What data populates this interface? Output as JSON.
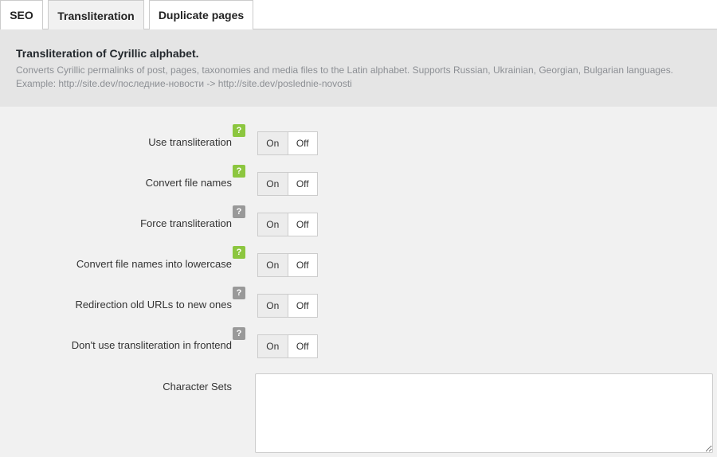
{
  "tabs": [
    {
      "label": "SEO"
    },
    {
      "label": "Transliteration"
    },
    {
      "label": "Duplicate pages"
    }
  ],
  "header": {
    "title": "Transliteration of Cyrillic alphabet.",
    "description": "Converts Cyrillic permalinks of post, pages, taxonomies and media files to the Latin alphabet. Supports Russian, Ukrainian, Georgian, Bulgarian languages. Example: http://site.dev/последние-новости -> http://site.dev/poslednie-novosti"
  },
  "settings": [
    {
      "label": "Use transliteration",
      "help_color": "#8cc63f",
      "on_label": "On",
      "off_label": "Off"
    },
    {
      "label": "Convert file names",
      "help_color": "#8cc63f",
      "on_label": "On",
      "off_label": "Off"
    },
    {
      "label": "Force transliteration",
      "help_color": "#999999",
      "on_label": "On",
      "off_label": "Off"
    },
    {
      "label": "Convert file names into lowercase",
      "help_color": "#8cc63f",
      "on_label": "On",
      "off_label": "Off"
    },
    {
      "label": "Redirection old URLs to new ones",
      "help_color": "#999999",
      "on_label": "On",
      "off_label": "Off"
    },
    {
      "label": "Don't use transliteration in frontend",
      "help_color": "#999999",
      "on_label": "On",
      "off_label": "Off"
    }
  ],
  "help_glyph": "?",
  "character_sets": {
    "label": "Character Sets",
    "value": ""
  }
}
